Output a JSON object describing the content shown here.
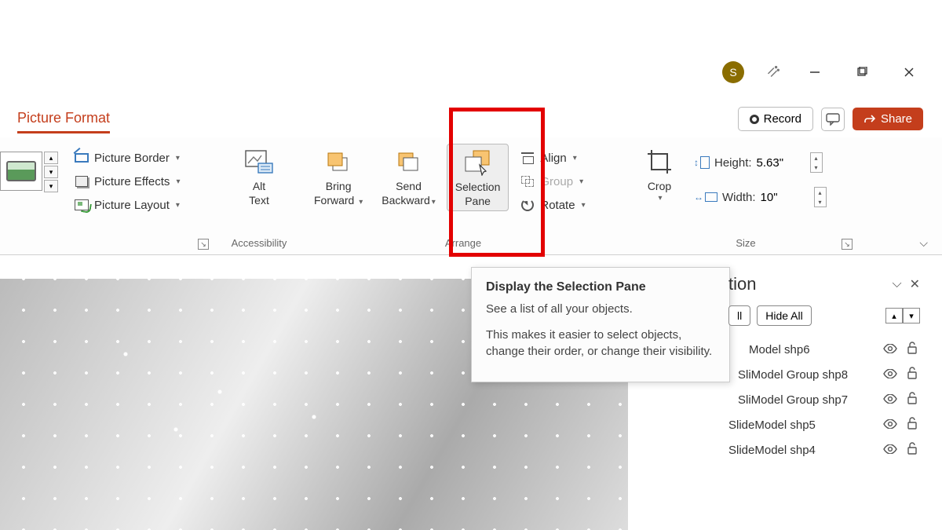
{
  "titlebar": {
    "avatar_letter": "S"
  },
  "tab": {
    "picture_format": "Picture Format"
  },
  "actions": {
    "record": "Record",
    "share": "Share"
  },
  "ribbon": {
    "styles": {
      "border": "Picture Border",
      "effects": "Picture Effects",
      "layout": "Picture Layout"
    },
    "accessibility_group": "Accessibility",
    "alt_text_line1": "Alt",
    "alt_text_line2": "Text",
    "arrange_group": "Arrange",
    "bring_forward_line1": "Bring",
    "bring_forward_line2": "Forward",
    "send_backward_line1": "Send",
    "send_backward_line2": "Backward",
    "selection_pane_line1": "Selection",
    "selection_pane_line2": "Pane",
    "align": "Align",
    "group": "Group",
    "rotate": "Rotate",
    "crop": "Crop",
    "size_group": "Size",
    "height_label": "Height:",
    "width_label": "Width:",
    "height_value": "5.63\"",
    "width_value": "10\""
  },
  "tooltip": {
    "title": "Display the Selection Pane",
    "line1": "See a list of all your objects.",
    "line2": "This makes it easier to select objects, change their order, or change their visibility."
  },
  "selection_pane": {
    "title_fragment": "tion",
    "show_all_fragment": "ll",
    "hide_all": "Hide All",
    "items": [
      {
        "label": "Model shp6",
        "indent": 34
      },
      {
        "label": "SliModel Group shp8",
        "indent": 20
      },
      {
        "label": "SliModel Group shp7",
        "indent": 20
      },
      {
        "label": "SlideModel shp5",
        "indent": 8
      },
      {
        "label": "SlideModel shp4",
        "indent": 8
      }
    ]
  }
}
